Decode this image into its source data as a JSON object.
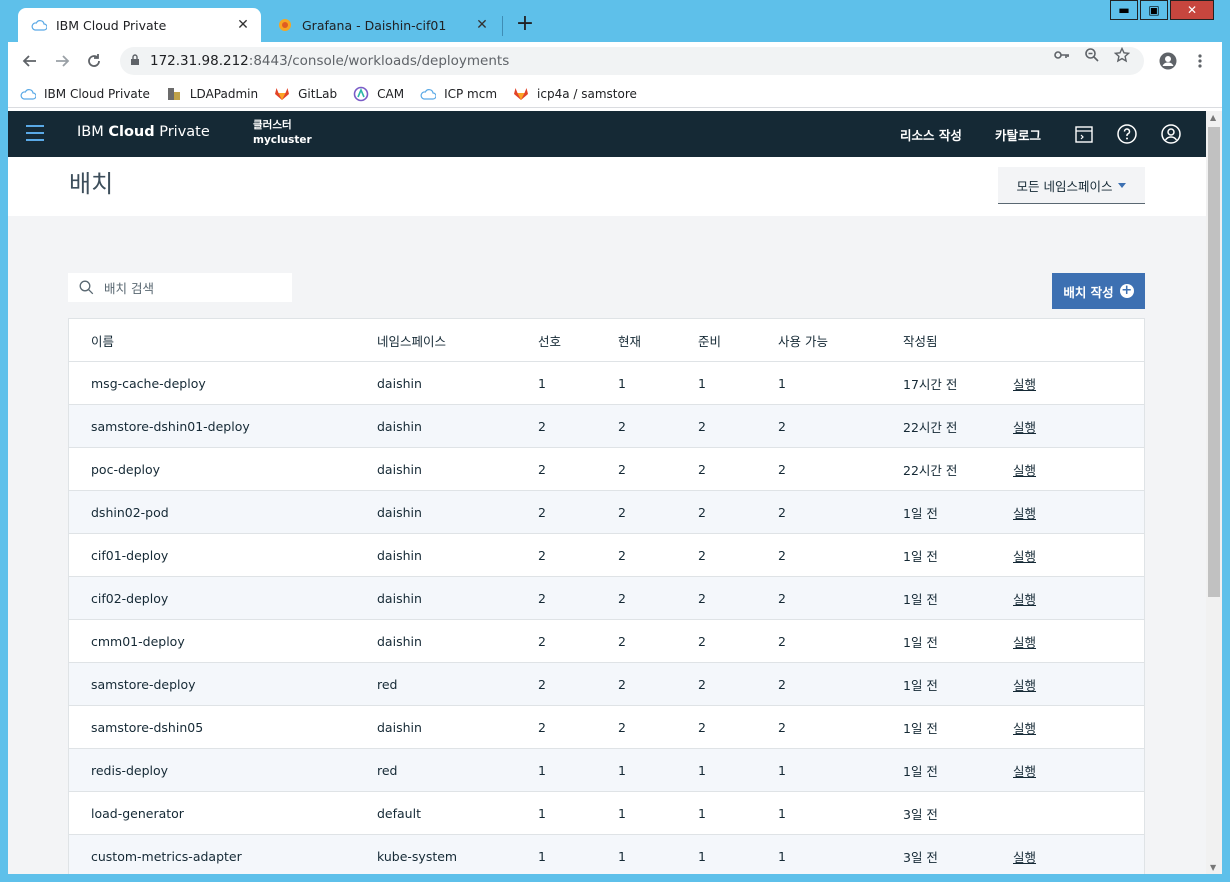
{
  "tabs": [
    {
      "label": "IBM Cloud Private",
      "active": true
    },
    {
      "label": "Grafana - Daishin-cif01",
      "active": false
    }
  ],
  "window_controls": {
    "minimize": "▬",
    "maximize": "▣",
    "close": "✕"
  },
  "address_bar": {
    "host": "172.31.98.212",
    "rest": ":8443/console/workloads/deployments"
  },
  "bookmarks": [
    {
      "label": "IBM Cloud Private",
      "icon": "cloud-icon"
    },
    {
      "label": "LDAPadmin",
      "icon": "ldap-icon"
    },
    {
      "label": "GitLab",
      "icon": "gitlab-icon"
    },
    {
      "label": "CAM",
      "icon": "cam-icon"
    },
    {
      "label": "ICP mcm",
      "icon": "cloud-icon"
    },
    {
      "label": "icp4a / samstore",
      "icon": "gitlab-icon"
    }
  ],
  "header": {
    "brand_prefix": "IBM ",
    "brand_bold": "Cloud",
    "brand_suffix": " Private",
    "cluster_label": "클러스터",
    "cluster_name": "mycluster",
    "create_resource": "리소스 작성",
    "catalog": "카탈로그"
  },
  "page": {
    "title": "배치",
    "namespace_select": "모든 네임스페이스",
    "search_placeholder": "배치 검색",
    "create_button": "배치 작성"
  },
  "table": {
    "columns": [
      "이름",
      "네임스페이스",
      "선호",
      "현재",
      "준비",
      "사용 가능",
      "작성됨"
    ],
    "rows": [
      {
        "name": "msg-cache-deploy",
        "namespace": "daishin",
        "desired": "1",
        "current": "1",
        "ready": "1",
        "available": "1",
        "created": "17시간 전",
        "action": "실행"
      },
      {
        "name": "samstore-dshin01-deploy",
        "namespace": "daishin",
        "desired": "2",
        "current": "2",
        "ready": "2",
        "available": "2",
        "created": "22시간 전",
        "action": "실행"
      },
      {
        "name": "poc-deploy",
        "namespace": "daishin",
        "desired": "2",
        "current": "2",
        "ready": "2",
        "available": "2",
        "created": "22시간 전",
        "action": "실행"
      },
      {
        "name": "dshin02-pod",
        "namespace": "daishin",
        "desired": "2",
        "current": "2",
        "ready": "2",
        "available": "2",
        "created": "1일 전",
        "action": "실행"
      },
      {
        "name": "cif01-deploy",
        "namespace": "daishin",
        "desired": "2",
        "current": "2",
        "ready": "2",
        "available": "2",
        "created": "1일 전",
        "action": "실행"
      },
      {
        "name": "cif02-deploy",
        "namespace": "daishin",
        "desired": "2",
        "current": "2",
        "ready": "2",
        "available": "2",
        "created": "1일 전",
        "action": "실행"
      },
      {
        "name": "cmm01-deploy",
        "namespace": "daishin",
        "desired": "2",
        "current": "2",
        "ready": "2",
        "available": "2",
        "created": "1일 전",
        "action": "실행"
      },
      {
        "name": "samstore-deploy",
        "namespace": "red",
        "desired": "2",
        "current": "2",
        "ready": "2",
        "available": "2",
        "created": "1일 전",
        "action": "실행"
      },
      {
        "name": "samstore-dshin05",
        "namespace": "daishin",
        "desired": "2",
        "current": "2",
        "ready": "2",
        "available": "2",
        "created": "1일 전",
        "action": "실행"
      },
      {
        "name": "redis-deploy",
        "namespace": "red",
        "desired": "1",
        "current": "1",
        "ready": "1",
        "available": "1",
        "created": "1일 전",
        "action": "실행"
      },
      {
        "name": "load-generator",
        "namespace": "default",
        "desired": "1",
        "current": "1",
        "ready": "1",
        "available": "1",
        "created": "3일 전",
        "action": ""
      },
      {
        "name": "custom-metrics-adapter",
        "namespace": "kube-system",
        "desired": "1",
        "current": "1",
        "ready": "1",
        "available": "1",
        "created": "3일 전",
        "action": "실행"
      }
    ]
  },
  "colors": {
    "header_bg": "#152935",
    "accent": "#3d70b2",
    "chrome": "#5ec0ea"
  }
}
